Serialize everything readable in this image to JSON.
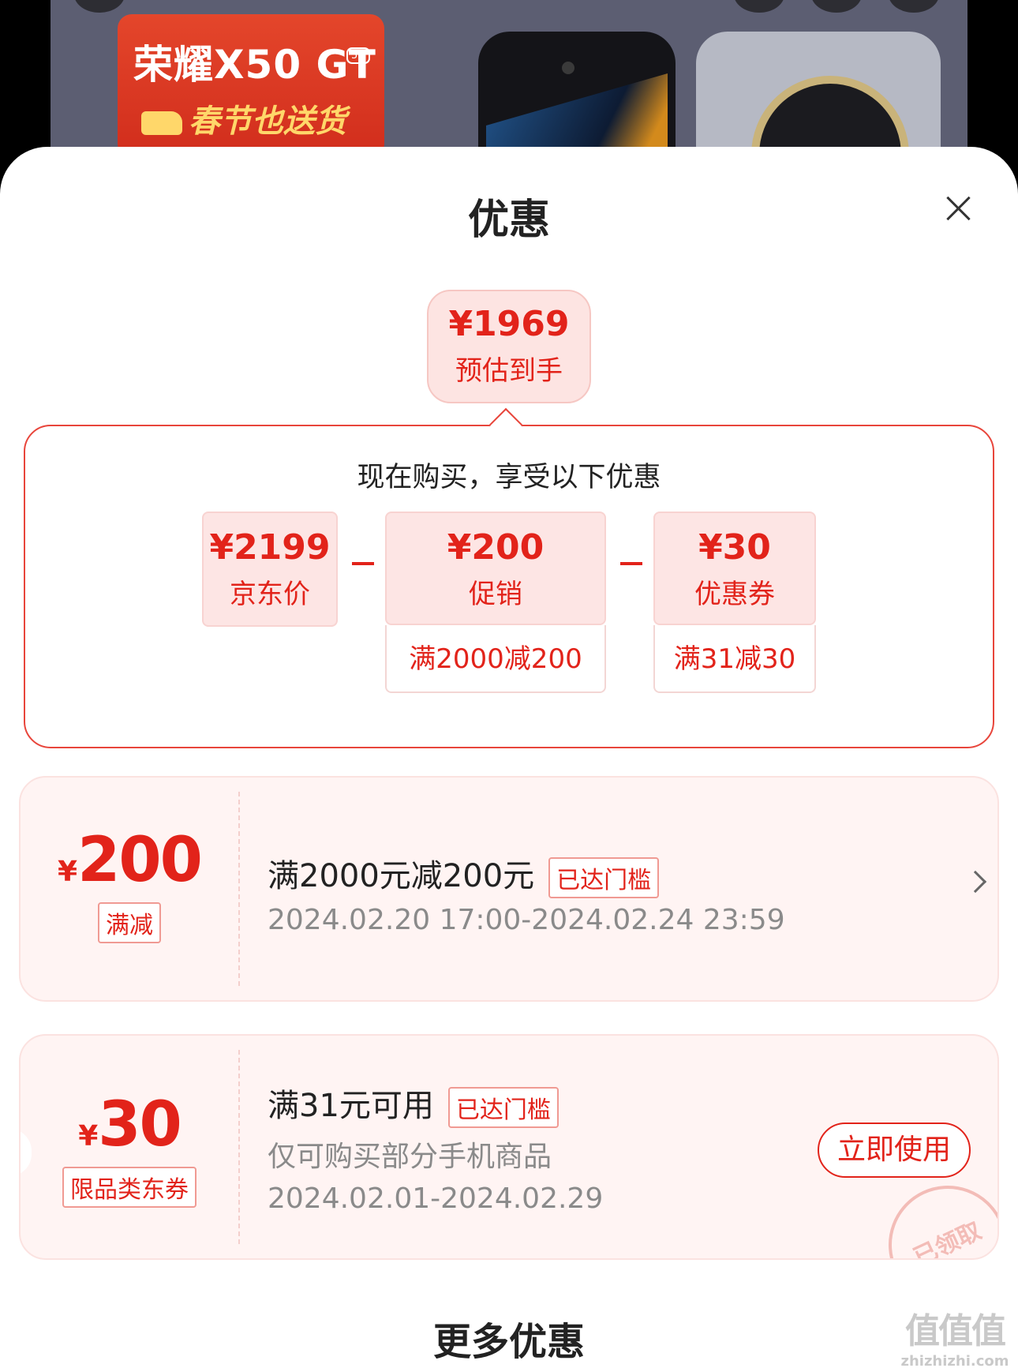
{
  "banner": {
    "product_name": "荣耀X50 GT",
    "network_badge": "5G",
    "promo_text": "春节也送货"
  },
  "sheet": {
    "title": "优惠",
    "estimate": {
      "price": "¥1969",
      "label": "预估到手"
    },
    "breakdown": {
      "heading": "现在购买，享受以下优惠",
      "items": [
        {
          "price": "¥2199",
          "label": "京东价",
          "condition": ""
        },
        {
          "price": "¥200",
          "label": "促销",
          "condition": "满2000减200"
        },
        {
          "price": "¥30",
          "label": "优惠券",
          "condition": "满31减30"
        }
      ]
    },
    "coupons": [
      {
        "yen": "¥",
        "amount": "200",
        "tag": "满减",
        "title": "满2000元减200元",
        "badge": "已达门槛",
        "period": "2024.02.20 17:00-2024.02.24 23:59"
      },
      {
        "yen": "¥",
        "amount": "30",
        "tag": "限品类东券",
        "title": "满31元可用",
        "badge": "已达门槛",
        "scope": "仅可购买部分手机商品",
        "period": "2024.02.01-2024.02.29",
        "action": "立即使用",
        "stamp": "已领取"
      }
    ],
    "more_title": "更多优惠"
  },
  "watermark": {
    "logo": "值值值",
    "url": "zhizhizhi.com"
  },
  "colors": {
    "accent": "#e2231a",
    "card_bg": "#fff4f3",
    "chip_bg": "#fde5e4"
  },
  "icons": [
    "close-icon",
    "chevron-right-icon",
    "truck-icon"
  ]
}
